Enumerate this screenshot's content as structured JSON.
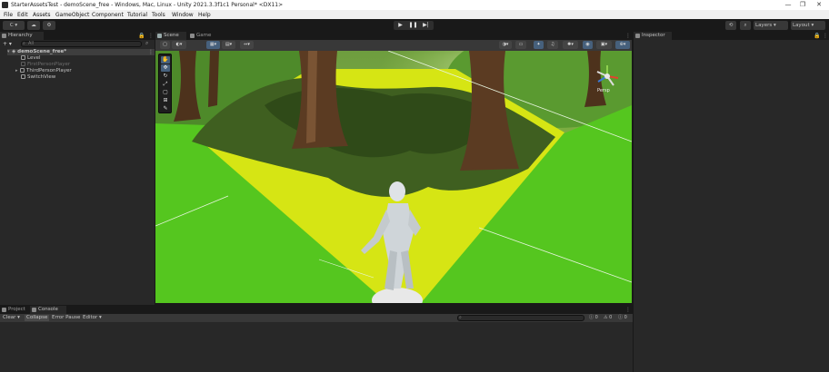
{
  "window": {
    "title": "StarterAssetsTest - demoScene_free - Windows, Mac, Linux - Unity 2021.3.3f1c1 Personal* <DX11>",
    "minimize_glyph": "—",
    "maximize_glyph": "❐",
    "close_glyph": "✕"
  },
  "menu": [
    "File",
    "Edit",
    "Assets",
    "GameObject",
    "Component",
    "Tutorial",
    "Tools",
    "Window",
    "Help"
  ],
  "toolbar": {
    "account_label": "C ▾",
    "cloud_glyph": "☁",
    "collab_glyph": "⚙",
    "play_glyph": "▶",
    "pause_glyph": "❚❚",
    "step_glyph": "▶|",
    "history_glyph": "⟲",
    "search_glyph": "⌕",
    "layers_label": "Layers",
    "layout_label": "Layout"
  },
  "hierarchy": {
    "tab_label": "Hierarchy",
    "add_label": "+ ▾",
    "search_placeholder": "All",
    "items": [
      {
        "label": "demoScene_free*",
        "type": "scene"
      },
      {
        "label": "Level",
        "type": "object"
      },
      {
        "label": "FirstPersonPlayer",
        "type": "disabled"
      },
      {
        "label": "ThirdPersonPlayer",
        "type": "object"
      },
      {
        "label": "SwitchView",
        "type": "object"
      }
    ]
  },
  "scene": {
    "tabs": [
      "Scene",
      "Game"
    ],
    "gizmo_label": "Persp",
    "colors": {
      "grass": "#55c61f",
      "yellow": "#d8e812",
      "trunk": "#5b3b22",
      "sky": "#6a9b3c"
    }
  },
  "inspector": {
    "tab_label": "Inspector"
  },
  "bottom": {
    "tabs": [
      "Project",
      "Console"
    ],
    "console_buttons": [
      "Clear ▾",
      "Collapse",
      "Error Pause",
      "Editor ▾"
    ],
    "counts": [
      "0",
      "0",
      "0"
    ]
  }
}
